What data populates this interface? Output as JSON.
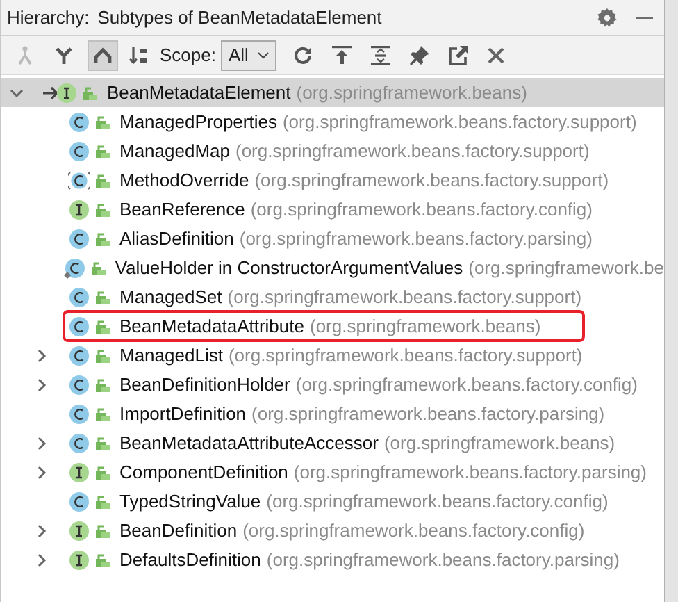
{
  "header": {
    "label": "Hierarchy:",
    "title": "Subtypes of BeanMetadataElement"
  },
  "toolbar": {
    "view_buttons": [
      {
        "kind": "supertypes",
        "selected": false,
        "disabled": true
      },
      {
        "kind": "subtypes",
        "selected": false,
        "disabled": false
      },
      {
        "kind": "hierarchy",
        "selected": true,
        "disabled": false
      }
    ],
    "scope_label": "Scope:",
    "scope_value": "All"
  },
  "tree": {
    "name": "BeanMetadataElement",
    "package": "(org.springframework.beans)",
    "kind": "interface",
    "expanded": true,
    "selected": true,
    "children": [
      {
        "name": "ManagedProperties",
        "package": "(org.springframework.beans.factory.support)",
        "kind": "class",
        "selected": false
      },
      {
        "name": "ManagedMap",
        "package": "(org.springframework.beans.factory.support)",
        "kind": "class",
        "selected": false
      },
      {
        "name": "MethodOverride",
        "package": "(org.springframework.beans.factory.support)",
        "kind": "abstract_class",
        "selected": false
      },
      {
        "name": "BeanReference",
        "package": "(org.springframework.beans.factory.config)",
        "kind": "interface",
        "selected": false
      },
      {
        "name": "AliasDefinition",
        "package": "(org.springframework.beans.factory.parsing)",
        "kind": "class",
        "selected": false
      },
      {
        "name": "ValueHolder in ConstructorArgumentValues",
        "package": "(org.springframework.be",
        "kind": "inner_class",
        "selected": false
      },
      {
        "name": "ManagedSet",
        "package": "(org.springframework.beans.factory.support)",
        "kind": "class",
        "selected": false
      },
      {
        "name": "BeanMetadataAttribute",
        "package": "(org.springframework.beans)",
        "kind": "class",
        "selected": false,
        "highlighted": true
      },
      {
        "name": "ManagedList",
        "package": "(org.springframework.beans.factory.support)",
        "kind": "class",
        "selected": false,
        "expanded": false
      },
      {
        "name": "BeanDefinitionHolder",
        "package": "(org.springframework.beans.factory.config)",
        "kind": "class",
        "selected": false,
        "expanded": false
      },
      {
        "name": "ImportDefinition",
        "package": "(org.springframework.beans.factory.parsing)",
        "kind": "class",
        "selected": false
      },
      {
        "name": "BeanMetadataAttributeAccessor",
        "package": "(org.springframework.beans)",
        "kind": "class",
        "selected": false,
        "expanded": false
      },
      {
        "name": "ComponentDefinition",
        "package": "(org.springframework.beans.factory.parsing)",
        "kind": "interface",
        "selected": false,
        "expanded": false
      },
      {
        "name": "TypedStringValue",
        "package": "(org.springframework.beans.factory.config)",
        "kind": "class",
        "selected": false
      },
      {
        "name": "BeanDefinition",
        "package": "(org.springframework.beans.factory.config)",
        "kind": "interface",
        "selected": false,
        "expanded": false
      },
      {
        "name": "DefaultsDefinition",
        "package": "(org.springframework.beans.factory.parsing)",
        "kind": "interface",
        "selected": false,
        "expanded": false
      }
    ]
  }
}
